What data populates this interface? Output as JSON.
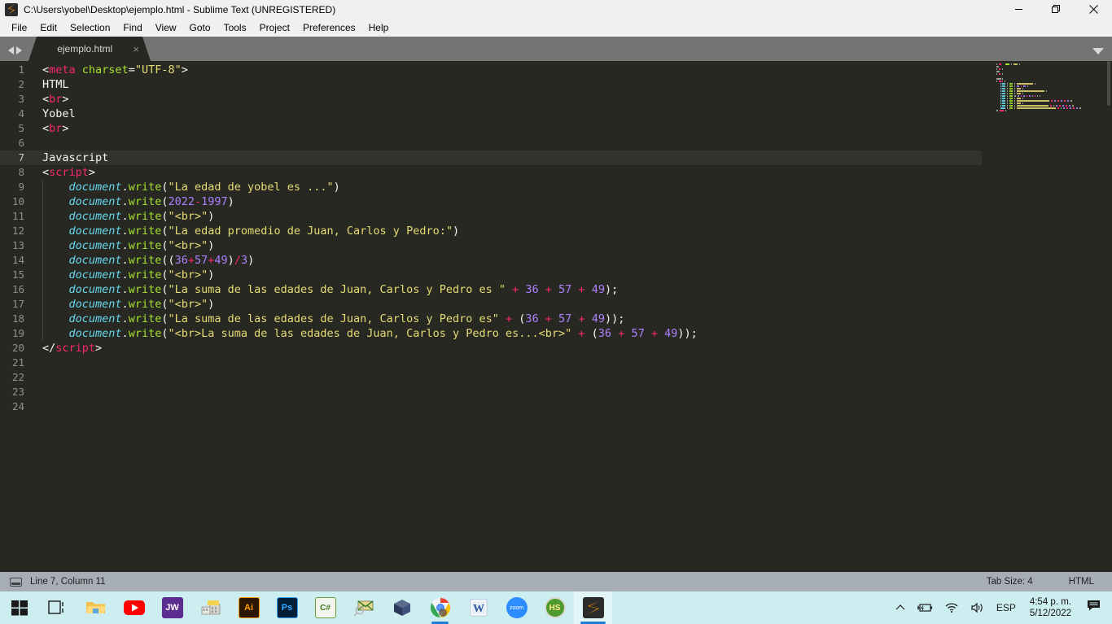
{
  "window": {
    "title": "C:\\Users\\yobel\\Desktop\\ejemplo.html - Sublime Text (UNREGISTERED)",
    "icon": "sublime-text-icon",
    "controls": {
      "minimize": "—",
      "maximize": "❐",
      "close": "✕"
    }
  },
  "menubar": {
    "items": [
      "File",
      "Edit",
      "Selection",
      "Find",
      "View",
      "Goto",
      "Tools",
      "Project",
      "Preferences",
      "Help"
    ]
  },
  "tabs": {
    "active": "ejemplo.html",
    "close_label": "×",
    "items": [
      {
        "label": "ejemplo.html"
      }
    ]
  },
  "editor": {
    "active_line": 7,
    "lines": [
      {
        "n": 1,
        "tokens": [
          {
            "t": "<",
            "c": "punct"
          },
          {
            "t": "meta",
            "c": "tag"
          },
          {
            "t": " ",
            "c": "punct"
          },
          {
            "t": "charset",
            "c": "attr"
          },
          {
            "t": "=",
            "c": "punct"
          },
          {
            "t": "\"UTF-8\"",
            "c": "str"
          },
          {
            "t": ">",
            "c": "punct"
          }
        ]
      },
      {
        "n": 2,
        "tokens": [
          {
            "t": "HTML",
            "c": "punct"
          }
        ]
      },
      {
        "n": 3,
        "tokens": [
          {
            "t": "<",
            "c": "punct"
          },
          {
            "t": "br",
            "c": "tag"
          },
          {
            "t": ">",
            "c": "punct"
          }
        ]
      },
      {
        "n": 4,
        "tokens": [
          {
            "t": "Yobel",
            "c": "punct"
          }
        ]
      },
      {
        "n": 5,
        "tokens": [
          {
            "t": "<",
            "c": "punct"
          },
          {
            "t": "br",
            "c": "tag"
          },
          {
            "t": ">",
            "c": "punct"
          }
        ]
      },
      {
        "n": 6,
        "tokens": []
      },
      {
        "n": 7,
        "tokens": [
          {
            "t": "Javascript",
            "c": "punct"
          }
        ]
      },
      {
        "n": 8,
        "tokens": [
          {
            "t": "<",
            "c": "punct"
          },
          {
            "t": "script",
            "c": "tag"
          },
          {
            "t": ">",
            "c": "punct"
          }
        ]
      },
      {
        "n": 9,
        "tokens": [
          {
            "t": "    ",
            "c": "punct"
          },
          {
            "t": "document",
            "c": "obj"
          },
          {
            "t": ".",
            "c": "punct"
          },
          {
            "t": "write",
            "c": "fn"
          },
          {
            "t": "(",
            "c": "punct"
          },
          {
            "t": "\"La edad de yobel es ...\"",
            "c": "str"
          },
          {
            "t": ")",
            "c": "punct"
          }
        ]
      },
      {
        "n": 10,
        "tokens": [
          {
            "t": "    ",
            "c": "punct"
          },
          {
            "t": "document",
            "c": "obj"
          },
          {
            "t": ".",
            "c": "punct"
          },
          {
            "t": "write",
            "c": "fn"
          },
          {
            "t": "(",
            "c": "punct"
          },
          {
            "t": "2022",
            "c": "num"
          },
          {
            "t": "-",
            "c": "op"
          },
          {
            "t": "1997",
            "c": "num"
          },
          {
            "t": ")",
            "c": "punct"
          }
        ]
      },
      {
        "n": 11,
        "tokens": [
          {
            "t": "    ",
            "c": "punct"
          },
          {
            "t": "document",
            "c": "obj"
          },
          {
            "t": ".",
            "c": "punct"
          },
          {
            "t": "write",
            "c": "fn"
          },
          {
            "t": "(",
            "c": "punct"
          },
          {
            "t": "\"<br>\"",
            "c": "str"
          },
          {
            "t": ")",
            "c": "punct"
          }
        ]
      },
      {
        "n": 12,
        "tokens": [
          {
            "t": "    ",
            "c": "punct"
          },
          {
            "t": "document",
            "c": "obj"
          },
          {
            "t": ".",
            "c": "punct"
          },
          {
            "t": "write",
            "c": "fn"
          },
          {
            "t": "(",
            "c": "punct"
          },
          {
            "t": "\"La edad promedio de Juan, Carlos y Pedro:\"",
            "c": "str"
          },
          {
            "t": ")",
            "c": "punct"
          }
        ]
      },
      {
        "n": 13,
        "tokens": [
          {
            "t": "    ",
            "c": "punct"
          },
          {
            "t": "document",
            "c": "obj"
          },
          {
            "t": ".",
            "c": "punct"
          },
          {
            "t": "write",
            "c": "fn"
          },
          {
            "t": "(",
            "c": "punct"
          },
          {
            "t": "\"<br>\"",
            "c": "str"
          },
          {
            "t": ")",
            "c": "punct"
          }
        ]
      },
      {
        "n": 14,
        "tokens": [
          {
            "t": "    ",
            "c": "punct"
          },
          {
            "t": "document",
            "c": "obj"
          },
          {
            "t": ".",
            "c": "punct"
          },
          {
            "t": "write",
            "c": "fn"
          },
          {
            "t": "((",
            "c": "punct"
          },
          {
            "t": "36",
            "c": "num"
          },
          {
            "t": "+",
            "c": "op"
          },
          {
            "t": "57",
            "c": "num"
          },
          {
            "t": "+",
            "c": "op"
          },
          {
            "t": "49",
            "c": "num"
          },
          {
            "t": ")",
            "c": "punct"
          },
          {
            "t": "/",
            "c": "op"
          },
          {
            "t": "3",
            "c": "num"
          },
          {
            "t": ")",
            "c": "punct"
          }
        ]
      },
      {
        "n": 15,
        "tokens": [
          {
            "t": "    ",
            "c": "punct"
          },
          {
            "t": "document",
            "c": "obj"
          },
          {
            "t": ".",
            "c": "punct"
          },
          {
            "t": "write",
            "c": "fn"
          },
          {
            "t": "(",
            "c": "punct"
          },
          {
            "t": "\"<br>\"",
            "c": "str"
          },
          {
            "t": ")",
            "c": "punct"
          }
        ]
      },
      {
        "n": 16,
        "tokens": [
          {
            "t": "    ",
            "c": "punct"
          },
          {
            "t": "document",
            "c": "obj"
          },
          {
            "t": ".",
            "c": "punct"
          },
          {
            "t": "write",
            "c": "fn"
          },
          {
            "t": "(",
            "c": "punct"
          },
          {
            "t": "\"La suma de las edades de Juan, Carlos y Pedro es \"",
            "c": "str"
          },
          {
            "t": " + ",
            "c": "op"
          },
          {
            "t": "36",
            "c": "num"
          },
          {
            "t": " + ",
            "c": "op"
          },
          {
            "t": "57",
            "c": "num"
          },
          {
            "t": " + ",
            "c": "op"
          },
          {
            "t": "49",
            "c": "num"
          },
          {
            "t": ");",
            "c": "punct"
          }
        ]
      },
      {
        "n": 17,
        "tokens": [
          {
            "t": "    ",
            "c": "punct"
          },
          {
            "t": "document",
            "c": "obj"
          },
          {
            "t": ".",
            "c": "punct"
          },
          {
            "t": "write",
            "c": "fn"
          },
          {
            "t": "(",
            "c": "punct"
          },
          {
            "t": "\"<br>\"",
            "c": "str"
          },
          {
            "t": ")",
            "c": "punct"
          }
        ]
      },
      {
        "n": 18,
        "tokens": [
          {
            "t": "    ",
            "c": "punct"
          },
          {
            "t": "document",
            "c": "obj"
          },
          {
            "t": ".",
            "c": "punct"
          },
          {
            "t": "write",
            "c": "fn"
          },
          {
            "t": "(",
            "c": "punct"
          },
          {
            "t": "\"La suma de las edades de Juan, Carlos y Pedro es\"",
            "c": "str"
          },
          {
            "t": " + ",
            "c": "op"
          },
          {
            "t": "(",
            "c": "punct"
          },
          {
            "t": "36",
            "c": "num"
          },
          {
            "t": " + ",
            "c": "op"
          },
          {
            "t": "57",
            "c": "num"
          },
          {
            "t": " + ",
            "c": "op"
          },
          {
            "t": "49",
            "c": "num"
          },
          {
            "t": "));",
            "c": "punct"
          }
        ]
      },
      {
        "n": 19,
        "tokens": [
          {
            "t": "    ",
            "c": "punct"
          },
          {
            "t": "document",
            "c": "obj"
          },
          {
            "t": ".",
            "c": "punct"
          },
          {
            "t": "write",
            "c": "fn"
          },
          {
            "t": "(",
            "c": "punct"
          },
          {
            "t": "\"<br>La suma de las edades de Juan, Carlos y Pedro es...<br>\"",
            "c": "str"
          },
          {
            "t": " + ",
            "c": "op"
          },
          {
            "t": "(",
            "c": "punct"
          },
          {
            "t": "36",
            "c": "num"
          },
          {
            "t": " + ",
            "c": "op"
          },
          {
            "t": "57",
            "c": "num"
          },
          {
            "t": " + ",
            "c": "op"
          },
          {
            "t": "49",
            "c": "num"
          },
          {
            "t": "));",
            "c": "punct"
          }
        ]
      },
      {
        "n": 20,
        "tokens": [
          {
            "t": "</",
            "c": "punct"
          },
          {
            "t": "script",
            "c": "tag"
          },
          {
            "t": ">",
            "c": "punct"
          }
        ]
      },
      {
        "n": 21,
        "tokens": []
      },
      {
        "n": 22,
        "tokens": []
      },
      {
        "n": 23,
        "tokens": []
      },
      {
        "n": 24,
        "tokens": []
      }
    ]
  },
  "statusbar": {
    "cursor": "Line 7, Column 11",
    "tab_size": "Tab Size: 4",
    "syntax": "HTML"
  },
  "taskbar": {
    "buttons": [
      {
        "name": "start-button",
        "icon": "windows-logo-icon",
        "label": ""
      },
      {
        "name": "task-view-button",
        "icon": "task-view-icon",
        "label": ""
      },
      {
        "name": "file-explorer-button",
        "icon": "folder-icon",
        "label": ""
      },
      {
        "name": "youtube-button",
        "icon": "youtube-icon",
        "label": ""
      },
      {
        "name": "jw-library-button",
        "icon": "jw-icon",
        "label": "JW"
      },
      {
        "name": "city-app-button",
        "icon": "city-icon",
        "label": ""
      },
      {
        "name": "illustrator-button",
        "icon": "illustrator-icon",
        "label": "Ai"
      },
      {
        "name": "photoshop-button",
        "icon": "photoshop-icon",
        "label": "Ps"
      },
      {
        "name": "csharp-button",
        "icon": "csharp-icon",
        "label": "C#"
      },
      {
        "name": "mail-search-button",
        "icon": "mail-magnifier-icon",
        "label": ""
      },
      {
        "name": "virtualbox-button",
        "icon": "virtualbox-icon",
        "label": ""
      },
      {
        "name": "chrome-button",
        "icon": "chrome-icon",
        "label": ""
      },
      {
        "name": "word-button",
        "icon": "word-icon",
        "label": "W"
      },
      {
        "name": "zoom-button",
        "icon": "zoom-icon",
        "label": "zoom"
      },
      {
        "name": "hs-button",
        "icon": "hs-icon",
        "label": "HS"
      },
      {
        "name": "sublime-text-button",
        "icon": "sublime-text-icon",
        "label": ""
      }
    ],
    "tray": {
      "show_hidden": "show-hidden-icons-chevron",
      "battery": "battery-charging-icon",
      "network": "wifi-icon",
      "volume": "speaker-icon",
      "language": "ESP",
      "time": "4:54 p. m.",
      "date": "5/12/2022",
      "notifications": "notification-icon"
    }
  },
  "colors": {
    "editor_bg": "#272822",
    "tag": "#f92672",
    "string": "#e6db74",
    "number": "#ae81ff",
    "function": "#a6e22e",
    "object": "#66d9ef",
    "taskbar": "#cdeef0",
    "statusbar": "#a7adb4"
  }
}
